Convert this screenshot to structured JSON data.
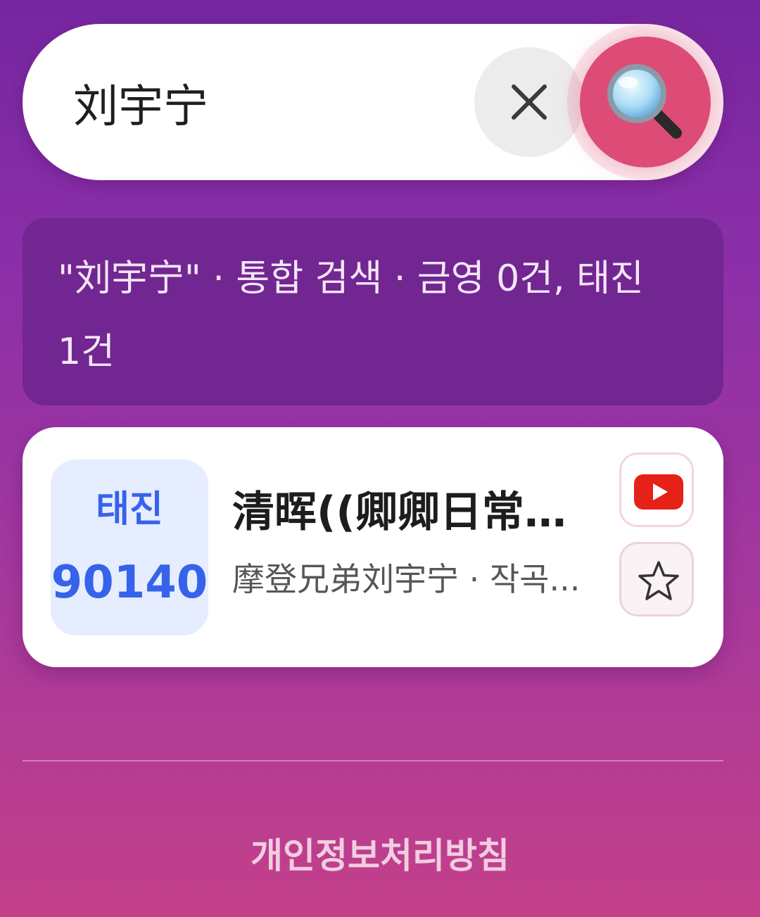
{
  "search": {
    "value": "刘宇宁",
    "clear_icon": "close-icon",
    "search_icon": "magnifier-icon"
  },
  "summary": {
    "text": "\"刘宇宁\" · 통합 검색 · 금영 0건, 태진 1건"
  },
  "results": [
    {
      "brand": "태진",
      "number": "90140",
      "title": "清晖((卿卿日常)...",
      "subtitle": "摩登兄弟刘宇宁 · 작곡...",
      "actions": [
        "youtube-icon",
        "star-icon"
      ]
    }
  ],
  "footer": {
    "privacy_label": "개인정보처리방침"
  },
  "colors": {
    "accent": "#dd4c76",
    "badge_text": "#3763ea",
    "badge_bg": "#e6edff",
    "youtube_red": "#e62117"
  }
}
